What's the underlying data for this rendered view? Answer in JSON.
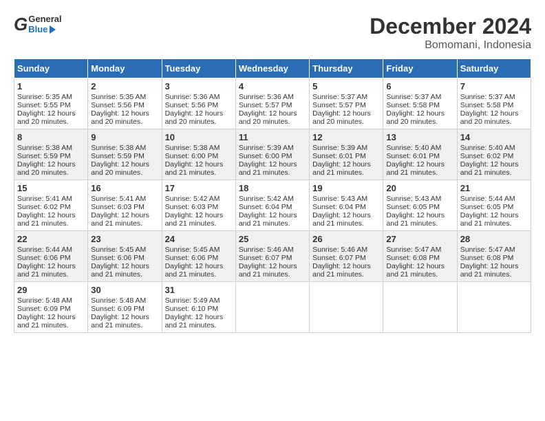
{
  "header": {
    "logo_general": "General",
    "logo_blue": "Blue",
    "title": "December 2024",
    "subtitle": "Bomomani, Indonesia"
  },
  "calendar": {
    "days_of_week": [
      "Sunday",
      "Monday",
      "Tuesday",
      "Wednesday",
      "Thursday",
      "Friday",
      "Saturday"
    ],
    "weeks": [
      [
        {
          "day": "1",
          "sunrise": "Sunrise: 5:35 AM",
          "sunset": "Sunset: 5:55 PM",
          "daylight": "Daylight: 12 hours and 20 minutes."
        },
        {
          "day": "2",
          "sunrise": "Sunrise: 5:35 AM",
          "sunset": "Sunset: 5:56 PM",
          "daylight": "Daylight: 12 hours and 20 minutes."
        },
        {
          "day": "3",
          "sunrise": "Sunrise: 5:36 AM",
          "sunset": "Sunset: 5:56 PM",
          "daylight": "Daylight: 12 hours and 20 minutes."
        },
        {
          "day": "4",
          "sunrise": "Sunrise: 5:36 AM",
          "sunset": "Sunset: 5:57 PM",
          "daylight": "Daylight: 12 hours and 20 minutes."
        },
        {
          "day": "5",
          "sunrise": "Sunrise: 5:37 AM",
          "sunset": "Sunset: 5:57 PM",
          "daylight": "Daylight: 12 hours and 20 minutes."
        },
        {
          "day": "6",
          "sunrise": "Sunrise: 5:37 AM",
          "sunset": "Sunset: 5:58 PM",
          "daylight": "Daylight: 12 hours and 20 minutes."
        },
        {
          "day": "7",
          "sunrise": "Sunrise: 5:37 AM",
          "sunset": "Sunset: 5:58 PM",
          "daylight": "Daylight: 12 hours and 20 minutes."
        }
      ],
      [
        {
          "day": "8",
          "sunrise": "Sunrise: 5:38 AM",
          "sunset": "Sunset: 5:59 PM",
          "daylight": "Daylight: 12 hours and 20 minutes."
        },
        {
          "day": "9",
          "sunrise": "Sunrise: 5:38 AM",
          "sunset": "Sunset: 5:59 PM",
          "daylight": "Daylight: 12 hours and 20 minutes."
        },
        {
          "day": "10",
          "sunrise": "Sunrise: 5:38 AM",
          "sunset": "Sunset: 6:00 PM",
          "daylight": "Daylight: 12 hours and 21 minutes."
        },
        {
          "day": "11",
          "sunrise": "Sunrise: 5:39 AM",
          "sunset": "Sunset: 6:00 PM",
          "daylight": "Daylight: 12 hours and 21 minutes."
        },
        {
          "day": "12",
          "sunrise": "Sunrise: 5:39 AM",
          "sunset": "Sunset: 6:01 PM",
          "daylight": "Daylight: 12 hours and 21 minutes."
        },
        {
          "day": "13",
          "sunrise": "Sunrise: 5:40 AM",
          "sunset": "Sunset: 6:01 PM",
          "daylight": "Daylight: 12 hours and 21 minutes."
        },
        {
          "day": "14",
          "sunrise": "Sunrise: 5:40 AM",
          "sunset": "Sunset: 6:02 PM",
          "daylight": "Daylight: 12 hours and 21 minutes."
        }
      ],
      [
        {
          "day": "15",
          "sunrise": "Sunrise: 5:41 AM",
          "sunset": "Sunset: 6:02 PM",
          "daylight": "Daylight: 12 hours and 21 minutes."
        },
        {
          "day": "16",
          "sunrise": "Sunrise: 5:41 AM",
          "sunset": "Sunset: 6:03 PM",
          "daylight": "Daylight: 12 hours and 21 minutes."
        },
        {
          "day": "17",
          "sunrise": "Sunrise: 5:42 AM",
          "sunset": "Sunset: 6:03 PM",
          "daylight": "Daylight: 12 hours and 21 minutes."
        },
        {
          "day": "18",
          "sunrise": "Sunrise: 5:42 AM",
          "sunset": "Sunset: 6:04 PM",
          "daylight": "Daylight: 12 hours and 21 minutes."
        },
        {
          "day": "19",
          "sunrise": "Sunrise: 5:43 AM",
          "sunset": "Sunset: 6:04 PM",
          "daylight": "Daylight: 12 hours and 21 minutes."
        },
        {
          "day": "20",
          "sunrise": "Sunrise: 5:43 AM",
          "sunset": "Sunset: 6:05 PM",
          "daylight": "Daylight: 12 hours and 21 minutes."
        },
        {
          "day": "21",
          "sunrise": "Sunrise: 5:44 AM",
          "sunset": "Sunset: 6:05 PM",
          "daylight": "Daylight: 12 hours and 21 minutes."
        }
      ],
      [
        {
          "day": "22",
          "sunrise": "Sunrise: 5:44 AM",
          "sunset": "Sunset: 6:06 PM",
          "daylight": "Daylight: 12 hours and 21 minutes."
        },
        {
          "day": "23",
          "sunrise": "Sunrise: 5:45 AM",
          "sunset": "Sunset: 6:06 PM",
          "daylight": "Daylight: 12 hours and 21 minutes."
        },
        {
          "day": "24",
          "sunrise": "Sunrise: 5:45 AM",
          "sunset": "Sunset: 6:06 PM",
          "daylight": "Daylight: 12 hours and 21 minutes."
        },
        {
          "day": "25",
          "sunrise": "Sunrise: 5:46 AM",
          "sunset": "Sunset: 6:07 PM",
          "daylight": "Daylight: 12 hours and 21 minutes."
        },
        {
          "day": "26",
          "sunrise": "Sunrise: 5:46 AM",
          "sunset": "Sunset: 6:07 PM",
          "daylight": "Daylight: 12 hours and 21 minutes."
        },
        {
          "day": "27",
          "sunrise": "Sunrise: 5:47 AM",
          "sunset": "Sunset: 6:08 PM",
          "daylight": "Daylight: 12 hours and 21 minutes."
        },
        {
          "day": "28",
          "sunrise": "Sunrise: 5:47 AM",
          "sunset": "Sunset: 6:08 PM",
          "daylight": "Daylight: 12 hours and 21 minutes."
        }
      ],
      [
        {
          "day": "29",
          "sunrise": "Sunrise: 5:48 AM",
          "sunset": "Sunset: 6:09 PM",
          "daylight": "Daylight: 12 hours and 21 minutes."
        },
        {
          "day": "30",
          "sunrise": "Sunrise: 5:48 AM",
          "sunset": "Sunset: 6:09 PM",
          "daylight": "Daylight: 12 hours and 21 minutes."
        },
        {
          "day": "31",
          "sunrise": "Sunrise: 5:49 AM",
          "sunset": "Sunset: 6:10 PM",
          "daylight": "Daylight: 12 hours and 21 minutes."
        },
        null,
        null,
        null,
        null
      ]
    ]
  }
}
